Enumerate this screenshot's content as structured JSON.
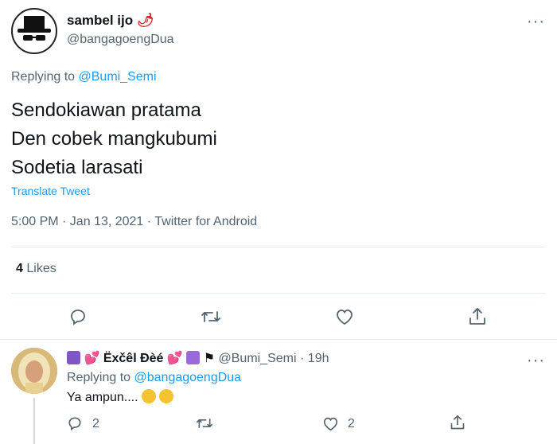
{
  "tweet": {
    "display_name": "sambel ijo",
    "name_emoji": "🌶",
    "handle": "@bangagoengDua",
    "replying_prefix": "Replying to",
    "replying_to": "@Bumi_Semi",
    "text_lines": [
      "Sendokiawan pratama",
      "Den cobek mangkubumi",
      "Sodetia larasati"
    ],
    "translate": "Translate Tweet",
    "meta": "5:00 PM · Jan 13, 2021 · Twitter for Android",
    "likes_count": "4",
    "likes_label": "Likes",
    "more": "···"
  },
  "reply": {
    "display_name": "Ëxčêl Ðèé",
    "handle": "@Bumi_Semi",
    "time": "· 19h",
    "replying_prefix": "Replying to",
    "replying_to": "@bangagoengDua",
    "text": "Ya ampun....",
    "reply_count": "2",
    "like_count": "2",
    "more": "···"
  },
  "colors": {
    "link": "#1d9bf0",
    "muted": "#536471",
    "divider": "#e6ecf0"
  },
  "icons": [
    "reply-icon",
    "retweet-icon",
    "like-icon",
    "share-icon",
    "more-icon"
  ]
}
